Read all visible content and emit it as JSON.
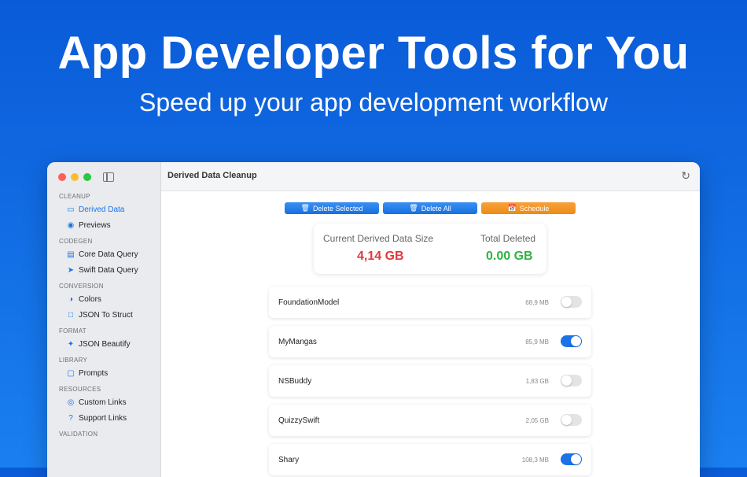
{
  "hero": {
    "title": "App Developer Tools for You",
    "subtitle": "Speed up your app development workflow"
  },
  "window": {
    "title": "Derived Data Cleanup"
  },
  "sidebar": {
    "sections": [
      {
        "title": "CLEANUP",
        "items": [
          {
            "label": "Derived Data",
            "icon": "folder-icon",
            "active": true
          },
          {
            "label": "Previews",
            "icon": "eye-icon"
          }
        ]
      },
      {
        "title": "CODEGEN",
        "items": [
          {
            "label": "Core Data Query",
            "icon": "database-icon"
          },
          {
            "label": "Swift Data Query",
            "icon": "swift-icon"
          }
        ]
      },
      {
        "title": "CONVERSION",
        "items": [
          {
            "label": "Colors",
            "icon": "palette-icon"
          },
          {
            "label": "JSON To Struct",
            "icon": "document-icon"
          }
        ]
      },
      {
        "title": "FORMAT",
        "items": [
          {
            "label": "JSON Beautify",
            "icon": "sparkles-icon"
          }
        ]
      },
      {
        "title": "LIBRARY",
        "items": [
          {
            "label": "Prompts",
            "icon": "chat-icon"
          }
        ]
      },
      {
        "title": "RESOURCES",
        "items": [
          {
            "label": "Custom Links",
            "icon": "compass-icon"
          },
          {
            "label": "Support Links",
            "icon": "question-icon"
          }
        ]
      },
      {
        "title": "VALIDATION",
        "items": []
      }
    ]
  },
  "toolbar": {
    "delete_selected": "Delete Selected",
    "delete_all": "Delete All",
    "schedule": "Schedule"
  },
  "stats": {
    "current_label": "Current Derived Data Size",
    "current_value": "4,14 GB",
    "current_color": "#e0393e",
    "total_label": "Total Deleted",
    "total_value": "0.00 GB",
    "total_color": "#2fb344"
  },
  "projects": [
    {
      "name": "FoundationModel",
      "size": "68,9 MB",
      "selected": false
    },
    {
      "name": "MyMangas",
      "size": "85,9 MB",
      "selected": true
    },
    {
      "name": "NSBuddy",
      "size": "1,83 GB",
      "selected": false
    },
    {
      "name": "QuizzySwift",
      "size": "2,05 GB",
      "selected": false
    },
    {
      "name": "Shary",
      "size": "108,3 MB",
      "selected": true
    }
  ],
  "colors": {
    "accent": "#1a73e8",
    "schedule": "#ee8a14"
  }
}
